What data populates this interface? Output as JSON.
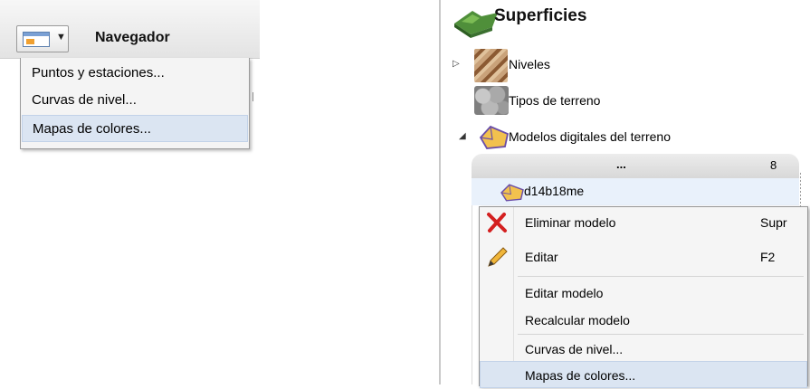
{
  "left_panel": {
    "toolbar_title": "Navegador",
    "view_button_icon": "window-view-icon",
    "dropdown_icon": "chevron-down-icon",
    "menu_items": [
      "Puntos y estaciones...",
      "Curvas de nivel...",
      "Mapas de colores..."
    ],
    "highlighted_item": "Mapas de colores..."
  },
  "tree": {
    "root_label": "Superficies",
    "root_icon": "terrain-surface-icon",
    "nodes": [
      {
        "label": "Niveles",
        "icon": "levels-texture-icon",
        "expander": "collapsed"
      },
      {
        "label": "Tipos de terreno",
        "icon": "stones-texture-icon"
      },
      {
        "label": "Modelos digitales del terreno",
        "icon": "dtm-model-icon",
        "expander": "expanded"
      }
    ],
    "group_header": {
      "label": "...",
      "count": "8"
    },
    "selected_model": "d14b18me"
  },
  "context_menu": {
    "items": [
      {
        "label": "Eliminar modelo",
        "shortcut": "Supr",
        "icon": "delete-x-icon"
      },
      {
        "label": "Editar",
        "shortcut": "F2",
        "icon": "pencil-icon"
      },
      {
        "label": "Editar modelo",
        "shortcut": ""
      },
      {
        "label": "Recalcular modelo",
        "shortcut": ""
      },
      {
        "label": "Curvas de nivel...",
        "shortcut": ""
      },
      {
        "label": "Mapas de colores...",
        "shortcut": ""
      }
    ],
    "highlighted_item": "Mapas de colores..."
  },
  "colors": {
    "menu_highlight": "#dbe5f2",
    "delete_icon": "#d42020",
    "dtm_icon": "#f2c14e"
  }
}
